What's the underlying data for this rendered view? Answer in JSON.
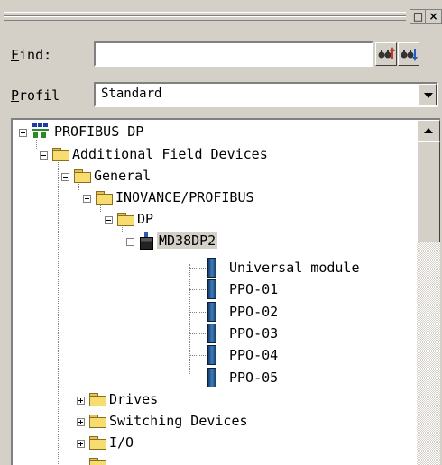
{
  "find": {
    "label_key": "F",
    "label_rest": "ind:",
    "value": ""
  },
  "profile": {
    "label_key": "P",
    "label_rest": "rofil",
    "selected": "Standard"
  },
  "window_buttons": {
    "restore": "□",
    "close": "×"
  },
  "tree": {
    "root": "PROFIBUS DP",
    "additional": "Additional Field Devices",
    "general": "General",
    "vendor": "INOVANCE/PROFIBUS",
    "dp": "DP",
    "slave": "MD38DP2",
    "modules": [
      "Universal module",
      "PPO-01",
      "PPO-02",
      "PPO-03",
      "PPO-04",
      "PPO-05"
    ],
    "drives": "Drives",
    "switching": "Switching Devices",
    "io": "I/O"
  }
}
